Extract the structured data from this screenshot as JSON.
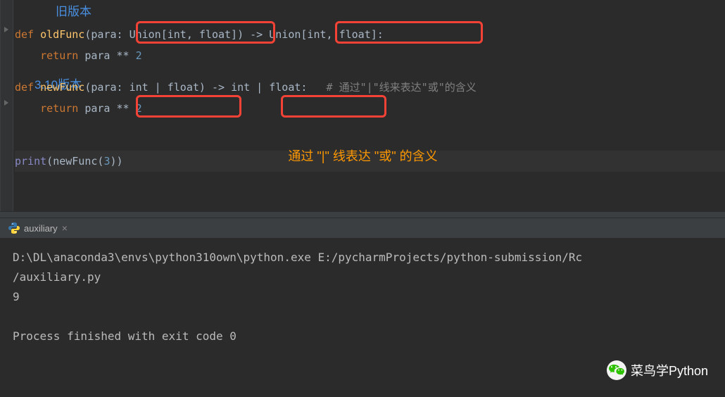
{
  "editor": {
    "labels": {
      "old_version": "旧版本",
      "new_version": "3.10版本"
    },
    "code": {
      "line1_def": "def",
      "line1_func": "oldFunc",
      "line1_param": "para",
      "line1_type1": "Union[int, float]",
      "line1_type2": "Union[int, float]",
      "line2_return": "return",
      "line2_expr_var": "para",
      "line2_expr_op": "**",
      "line2_expr_num": "2",
      "line4_def": "def",
      "line4_func": "newFunc",
      "line4_param": "para",
      "line4_type1": "int | float",
      "line4_type2": "int | float",
      "line4_comment": "# 通过\"|\"线来表达\"或\"的含义",
      "line5_return": "return",
      "line5_expr_var": "para",
      "line5_expr_op": "**",
      "line5_expr_num": "2",
      "line7_print": "print",
      "line7_call": "newFunc",
      "line7_arg": "3"
    },
    "center_annotation": "通过 \"|\" 线表达 \"或\" 的含义"
  },
  "tabs": {
    "active": "auxiliary",
    "close_glyph": "×"
  },
  "terminal": {
    "command": "D:\\DL\\anaconda3\\envs\\python310own\\python.exe E:/pycharmProjects/python-submission/Rc",
    "command_cont": "/auxiliary.py",
    "output": "9",
    "status": "Process finished with exit code 0"
  },
  "watermark": {
    "text": "菜鸟学Python"
  }
}
